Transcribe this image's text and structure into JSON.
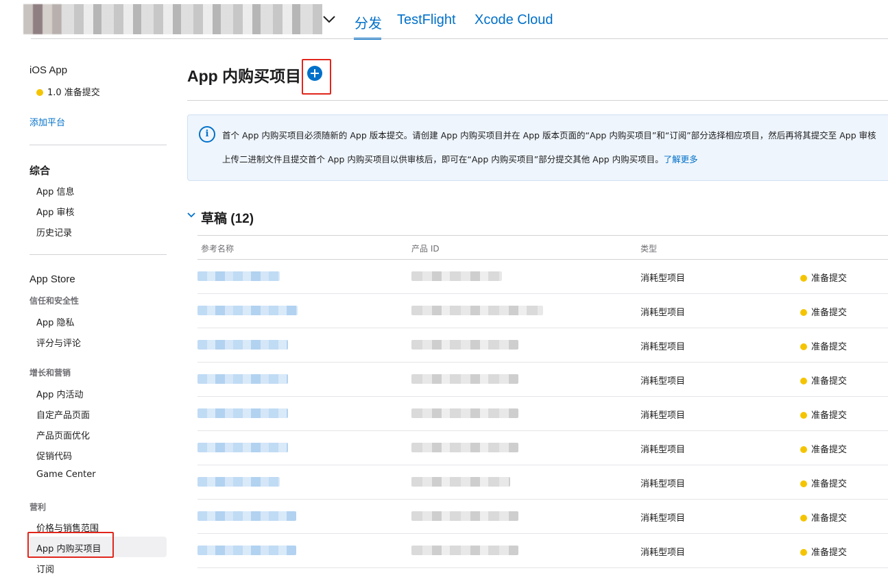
{
  "header": {
    "tabs": [
      {
        "label": "分发",
        "active": true
      },
      {
        "label": "TestFlight",
        "active": false
      },
      {
        "label": "Xcode Cloud",
        "active": false
      }
    ]
  },
  "sidebar": {
    "ios_app": {
      "title": "iOS App",
      "version_status": "1.0 准备提交"
    },
    "add_platform": "添加平台",
    "general": {
      "title": "综合",
      "items": [
        "App 信息",
        "App 审核",
        "历史记录"
      ]
    },
    "app_store": {
      "title": "App Store",
      "trust": {
        "title": "信任和安全性",
        "items": [
          "App 隐私",
          "评分与评论"
        ]
      },
      "growth": {
        "title": "增长和营销",
        "items": [
          "App 内活动",
          "自定产品页面",
          "产品页面优化",
          "促销代码",
          "Game Center"
        ]
      },
      "monetization": {
        "title": "营利",
        "items": [
          "价格与销售范围",
          "App 内购买项目",
          "订阅"
        ]
      }
    }
  },
  "main": {
    "title": "App 内购买项目",
    "info": {
      "line1": "首个 App 内购买项目必须随新的 App 版本提交。请创建 App 内购买项目并在 App 版本页面的“App 内购买项目”和“订阅”部分选择相应项目，然后再将其提交至 App 审核",
      "line2": "上传二进制文件且提交首个 App 内购买项目以供审核后，即可在“App 内购买项目”部分提交其他 App 内购买项目。",
      "link": "了解更多"
    },
    "section_title": "草稿 (12)",
    "columns": [
      "参考名称",
      "产品 ID",
      "类型"
    ],
    "rows": [
      {
        "type": "消耗型项目",
        "status": "准备提交"
      },
      {
        "type": "消耗型项目",
        "status": "准备提交"
      },
      {
        "type": "消耗型项目",
        "status": "准备提交"
      },
      {
        "type": "消耗型项目",
        "status": "准备提交"
      },
      {
        "type": "消耗型项目",
        "status": "准备提交"
      },
      {
        "type": "消耗型项目",
        "status": "准备提交"
      },
      {
        "type": "消耗型项目",
        "status": "准备提交"
      },
      {
        "type": "消耗型项目",
        "status": "准备提交"
      },
      {
        "type": "消耗型项目",
        "status": "准备提交"
      }
    ]
  },
  "colors": {
    "accent": "#0070c9",
    "status_yellow": "#f5c400",
    "highlight_red": "#e1251b"
  },
  "icons": [
    "chevron-down-icon",
    "add-circle-icon",
    "info-icon",
    "status-dot-icon"
  ]
}
